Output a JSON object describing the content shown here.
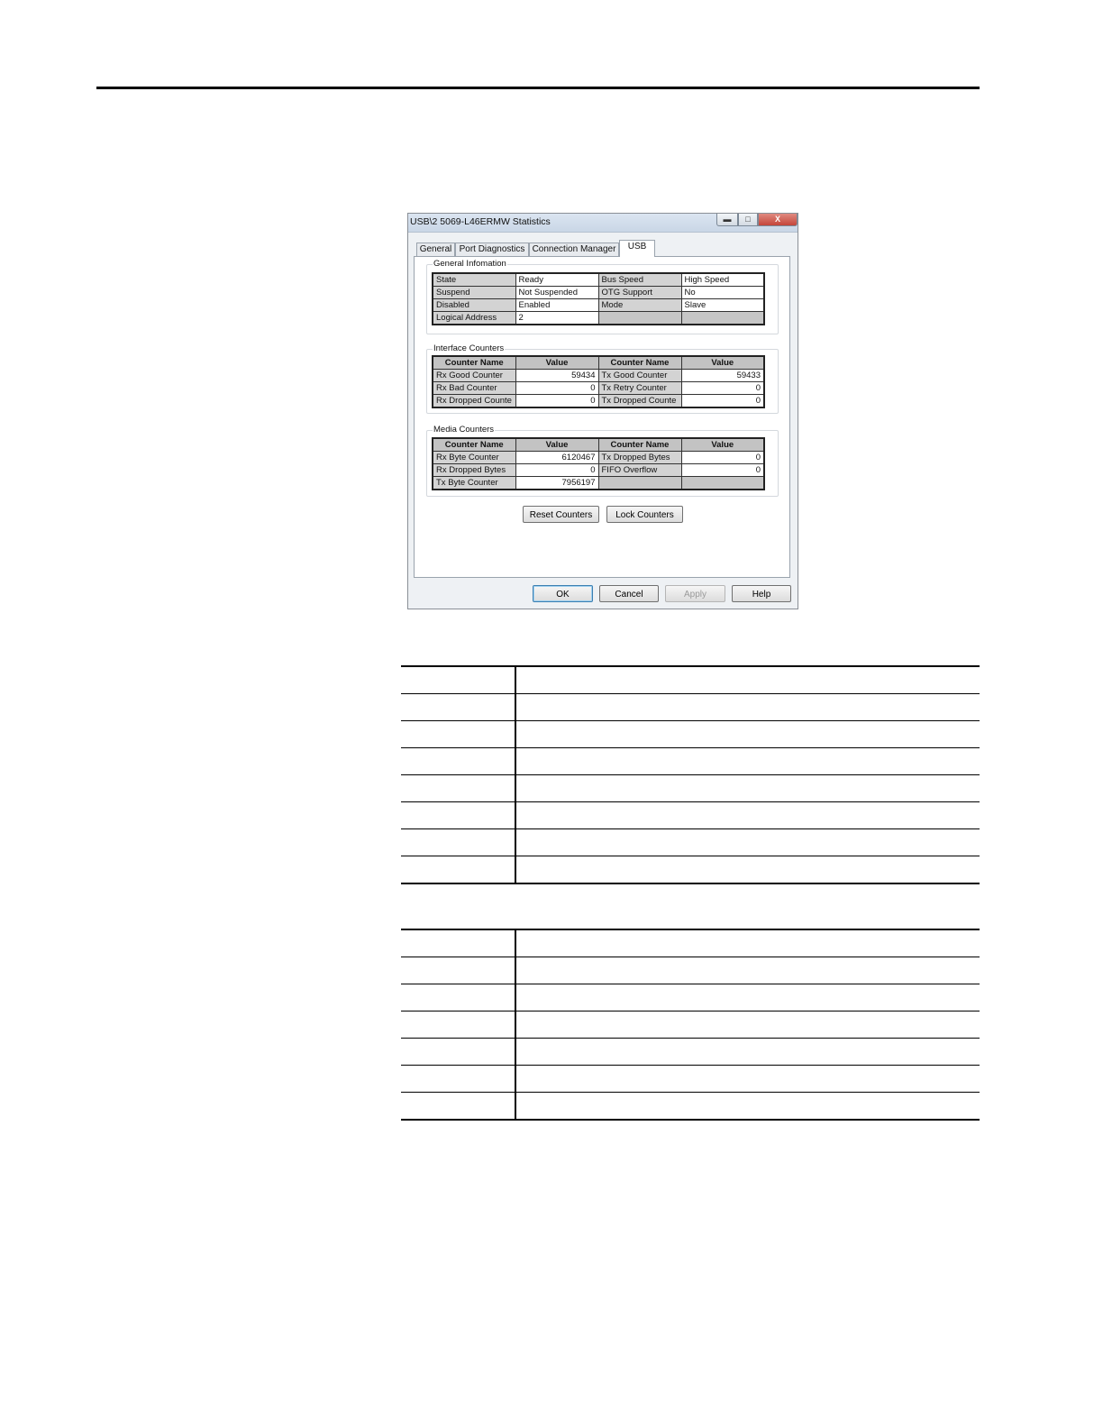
{
  "dialog": {
    "title": "USB\\2 5069-L46ERMW Statistics",
    "window_controls": {
      "minimize": "▬",
      "maximize": "□",
      "close": "X"
    },
    "tabs": [
      "General",
      "Port Diagnostics",
      "Connection Manager",
      "USB"
    ],
    "active_tab": "USB",
    "general_information": {
      "label": "General Infomation",
      "rows": [
        [
          "State",
          "Ready",
          "Bus Speed",
          "High Speed"
        ],
        [
          "Suspend",
          "Not Suspended",
          "OTG Support",
          "No"
        ],
        [
          "Disabled",
          "Enabled",
          "Mode",
          "Slave"
        ],
        [
          "Logical Address",
          "2",
          "",
          ""
        ]
      ]
    },
    "interface_counters": {
      "label": "Interface Counters",
      "headers": [
        "Counter Name",
        "Value",
        "Counter Name",
        "Value"
      ],
      "rows": [
        [
          "Rx Good Counter",
          "59434",
          "Tx Good Counter",
          "59433"
        ],
        [
          "Rx Bad Counter",
          "0",
          "Tx Retry Counter",
          "0"
        ],
        [
          "Rx Dropped Counte",
          "0",
          "Tx Dropped Counte",
          "0"
        ]
      ]
    },
    "media_counters": {
      "label": "Media Counters",
      "headers": [
        "Counter Name",
        "Value",
        "Counter Name",
        "Value"
      ],
      "rows": [
        [
          "Rx Byte Counter",
          "6120467",
          "Tx Dropped Bytes",
          "0"
        ],
        [
          "Rx Dropped Bytes",
          "0",
          "FIFO Overflow",
          "0"
        ],
        [
          "Tx Byte Counter",
          "7956197",
          "",
          ""
        ]
      ]
    },
    "buttons": {
      "reset_counters": "Reset Counters",
      "lock_counters": "Lock Counters",
      "ok": "OK",
      "cancel": "Cancel",
      "apply": "Apply",
      "help": "Help"
    }
  },
  "doc_tables": [
    {
      "rows": 8
    },
    {
      "rows": 7
    }
  ]
}
